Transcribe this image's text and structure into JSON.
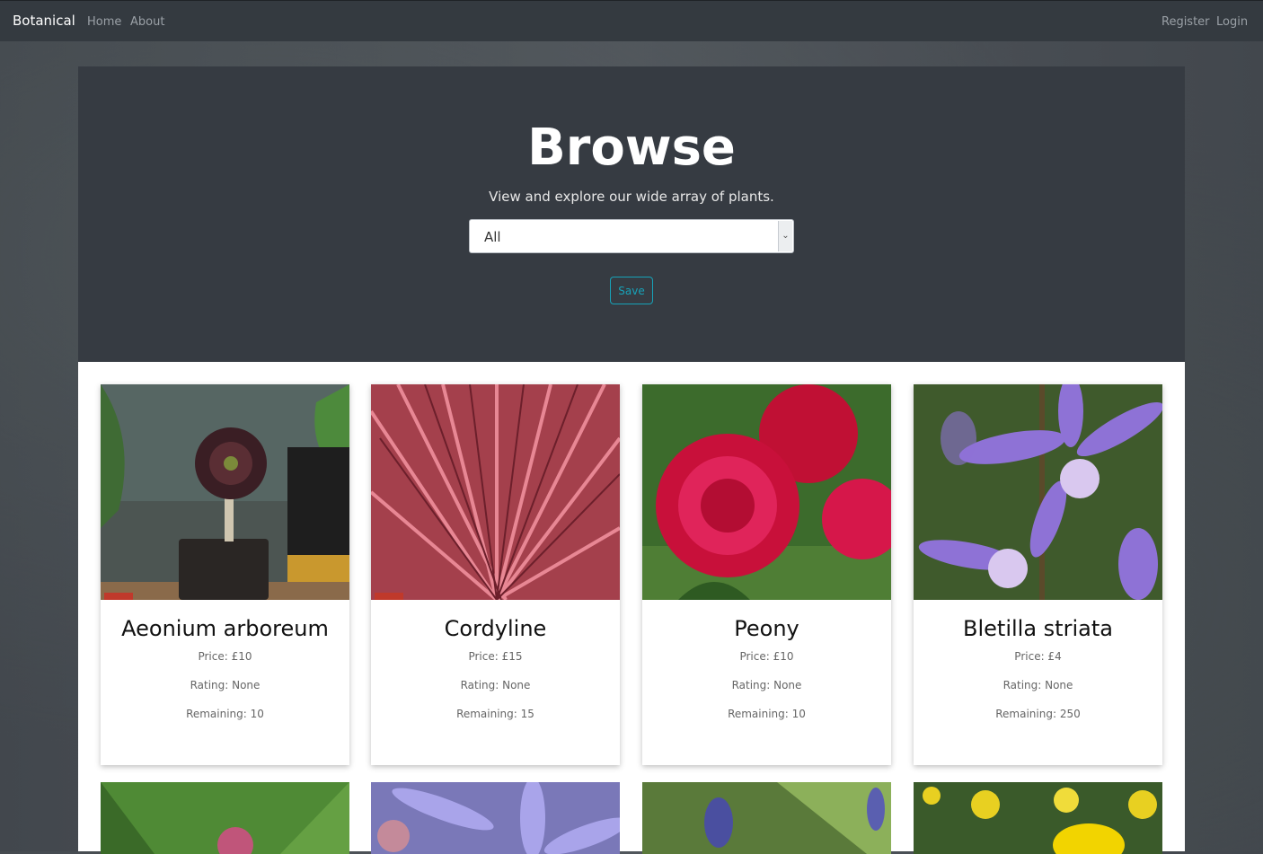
{
  "navbar": {
    "brand": "Botanical",
    "links": [
      "Home",
      "About"
    ],
    "right_links": [
      "Register",
      "Login"
    ]
  },
  "hero": {
    "title": "Browse",
    "subtitle": "View and explore our wide array of plants.",
    "filter_value": "All",
    "save_label": "Save"
  },
  "products": [
    {
      "name": "Aeonium arboreum",
      "price": "Price: £10",
      "rating": "Rating: None",
      "remaining": "Remaining: 10"
    },
    {
      "name": "Cordyline",
      "price": "Price: £15",
      "rating": "Rating: None",
      "remaining": "Remaining: 15"
    },
    {
      "name": "Peony",
      "price": "Price: £10",
      "rating": "Rating: None",
      "remaining": "Remaining: 10"
    },
    {
      "name": "Bletilla striata",
      "price": "Price: £4",
      "rating": "Rating: None",
      "remaining": "Remaining: 250"
    }
  ],
  "colors": {
    "navbar": "#343a40",
    "jumbotron": "#363b42",
    "accent": "#17a2b8"
  }
}
